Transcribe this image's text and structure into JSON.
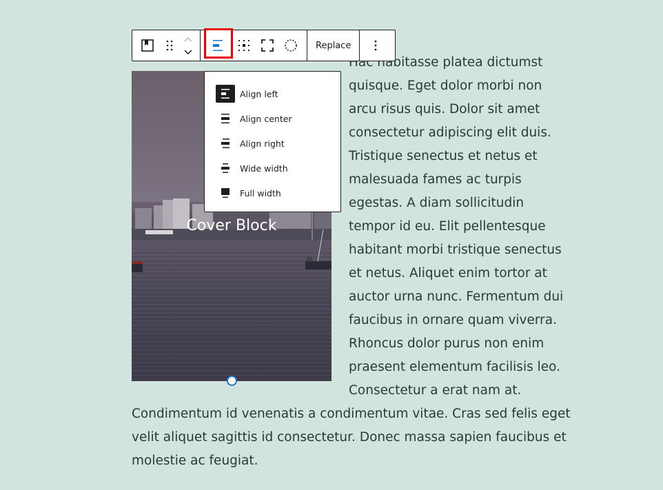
{
  "toolbar": {
    "replace_label": "Replace",
    "active_button": "align"
  },
  "cover": {
    "title": "Cover Block"
  },
  "dropdown": {
    "items": [
      {
        "label": "Align left",
        "icon": "align-left-icon",
        "selected": true
      },
      {
        "label": "Align center",
        "icon": "align-center-icon",
        "selected": false
      },
      {
        "label": "Align right",
        "icon": "align-right-icon",
        "selected": false
      },
      {
        "label": "Wide width",
        "icon": "wide-width-icon",
        "selected": false
      },
      {
        "label": "Full width",
        "icon": "full-width-icon",
        "selected": false
      }
    ]
  },
  "paragraph": {
    "right_lines": [
      "Hac habitasse platea dictumst",
      "quisque. Eget dolor morbi non",
      "arcu risus quis. Dolor sit amet",
      "consectetur adipiscing elit duis.",
      "Tristique senectus et netus et",
      "malesuada fames ac turpis",
      "egestas. A diam sollicitudin",
      "tempor id eu. Elit pellentesque",
      "habitant morbi tristique senectus",
      "et netus. Aliquet enim tortor at",
      "auctor urna nunc. Fermentum dui",
      "faucibus in ornare quam viverra.",
      "Rhoncus dolor purus non enim",
      "praesent elementum facilisis leo.",
      "Consectetur a erat nam at."
    ],
    "bottom_lines": [
      "Condimentum id venenatis a condimentum vitae. Cras sed felis eget",
      "velit aliquet sagittis id consectetur. Donec massa sapien faucibus et",
      "molestie ac feugiat."
    ]
  },
  "colors": {
    "background": "#d2e4de",
    "accent": "#1e78c8",
    "highlight": "#e8000b",
    "text": "#2b3a35"
  }
}
